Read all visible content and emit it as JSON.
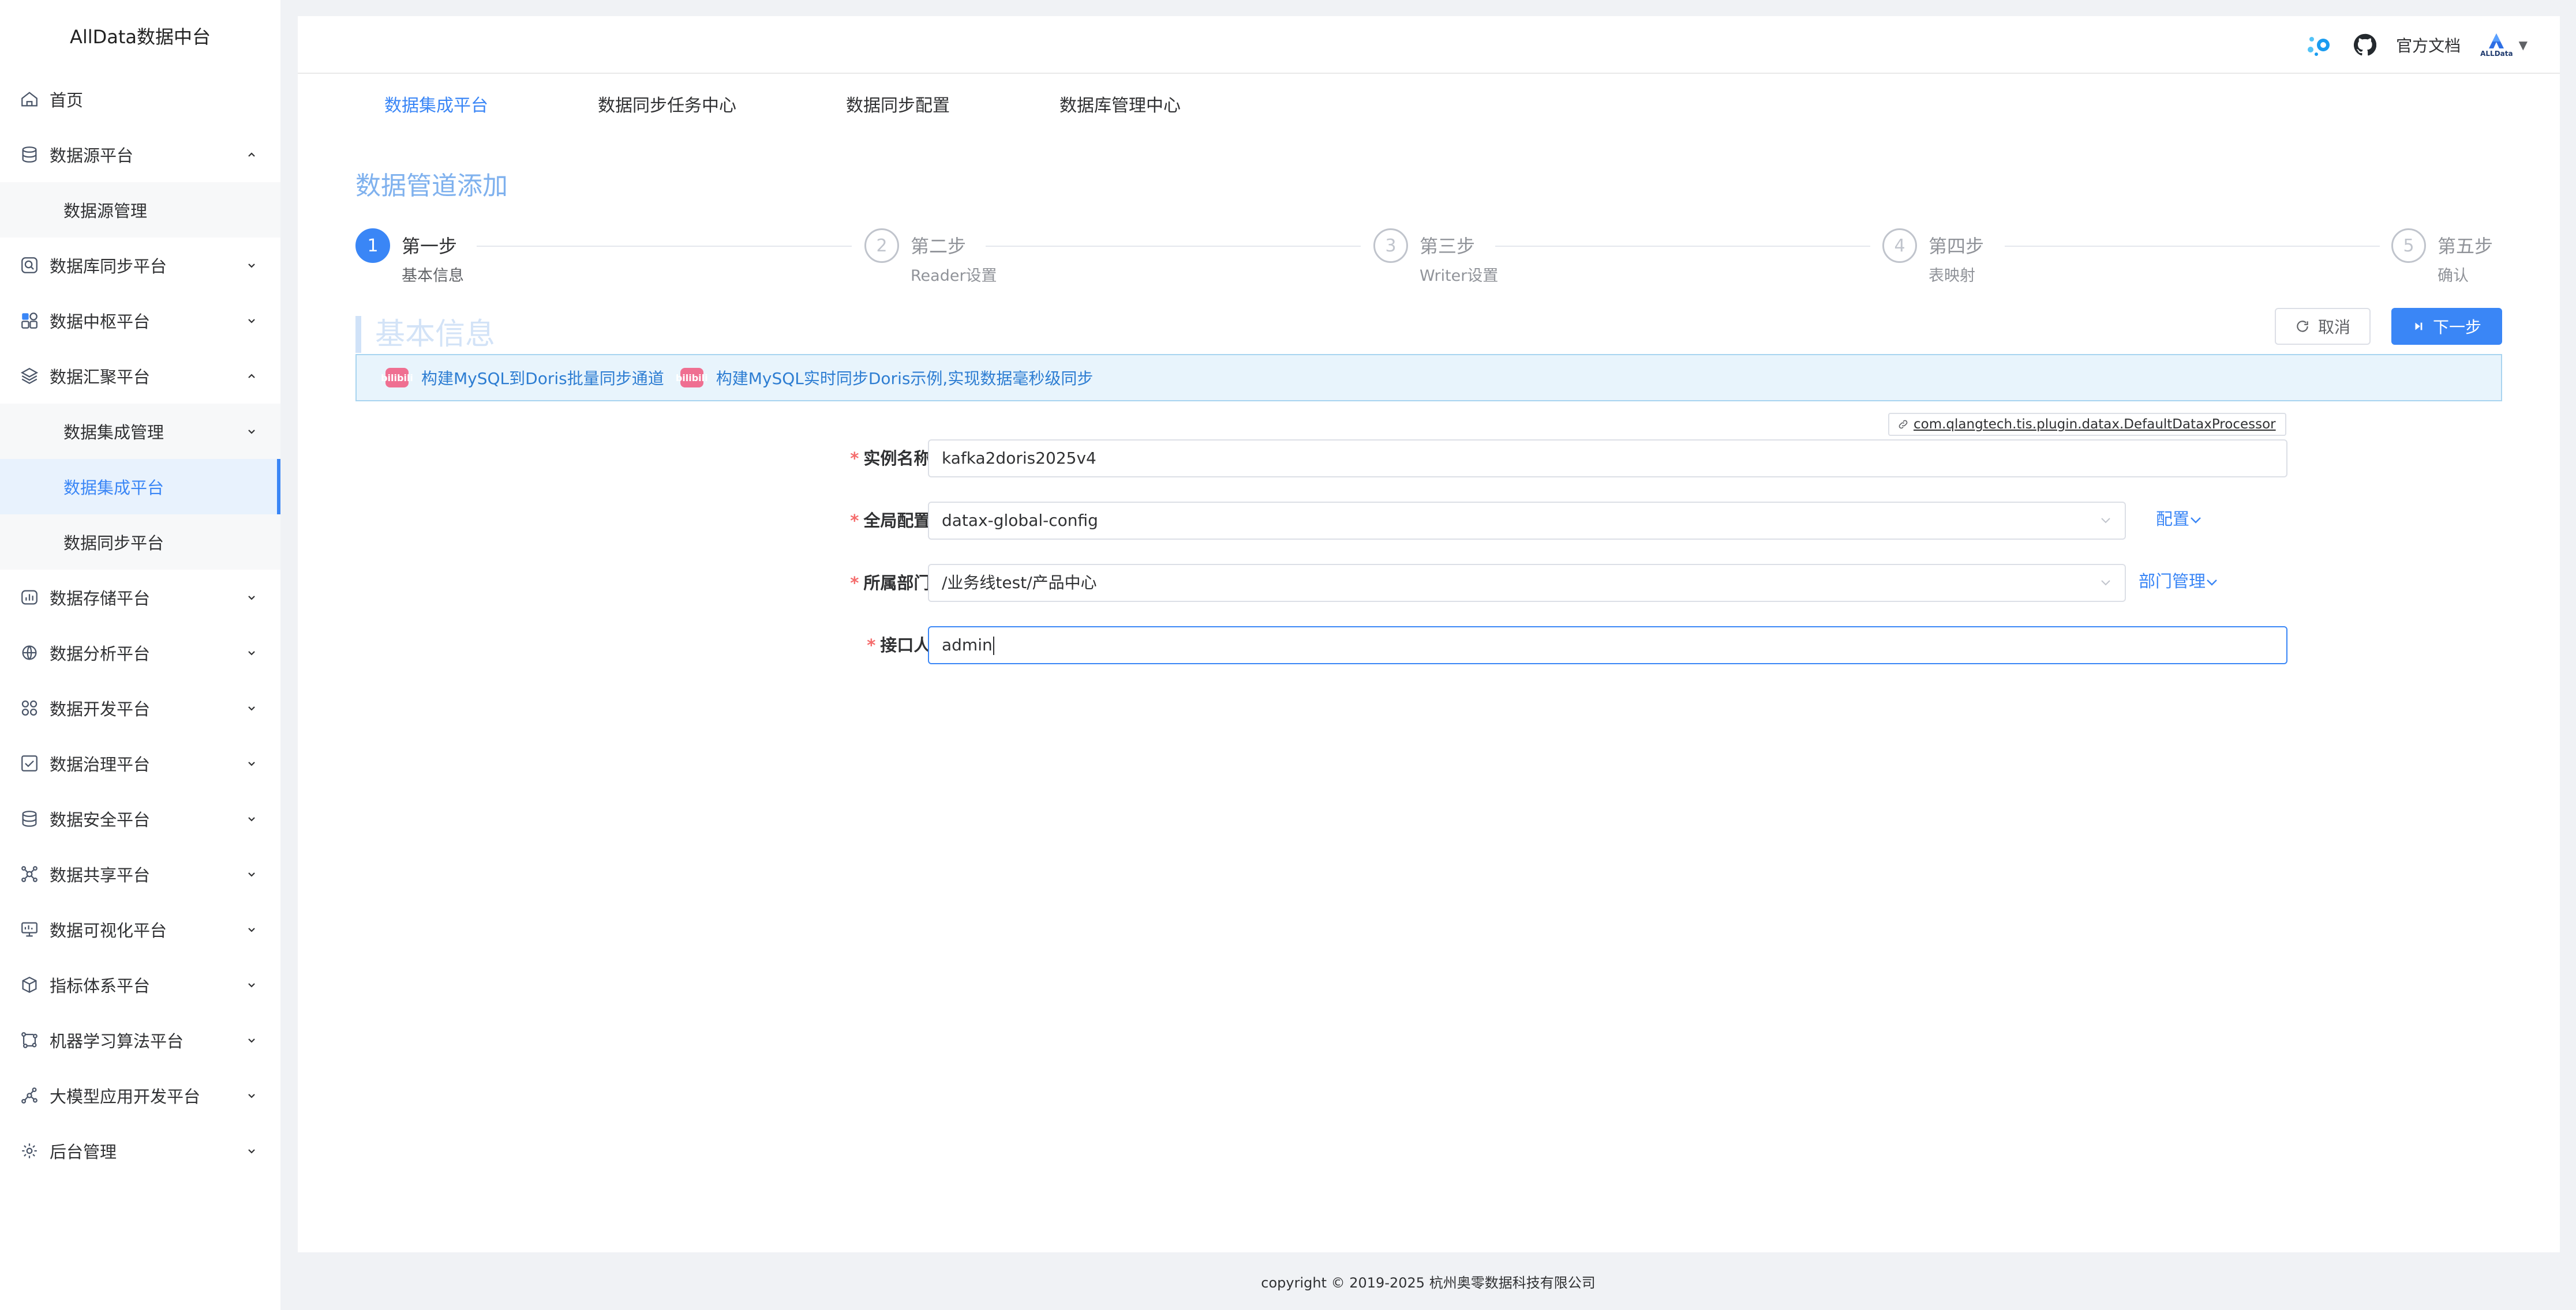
{
  "sidebar": {
    "logo": "AllData数据中台",
    "items": [
      {
        "label": "首页",
        "icon": "home-icon",
        "expanded": null
      },
      {
        "label": "数据源平台",
        "icon": "database-icon",
        "expanded": true
      },
      {
        "label": "数据源管理",
        "sub": true
      },
      {
        "label": "数据库同步平台",
        "icon": "sync-search-icon",
        "expanded": false
      },
      {
        "label": "数据中枢平台",
        "icon": "apps-icon",
        "expanded": false
      },
      {
        "label": "数据汇聚平台",
        "icon": "layers-icon",
        "expanded": true
      },
      {
        "label": "数据集成管理",
        "sub": true,
        "expanded": false
      },
      {
        "label": "数据集成平台",
        "sub": true,
        "active": true
      },
      {
        "label": "数据同步平台",
        "sub": true
      },
      {
        "label": "数据存储平台",
        "icon": "storage-chart-icon",
        "expanded": false
      },
      {
        "label": "数据分析平台",
        "icon": "analysis-icon",
        "expanded": false
      },
      {
        "label": "数据开发平台",
        "icon": "dev-grid-icon",
        "expanded": false
      },
      {
        "label": "数据治理平台",
        "icon": "checkbox-icon",
        "expanded": false
      },
      {
        "label": "数据安全平台",
        "icon": "security-db-icon",
        "expanded": false
      },
      {
        "label": "数据共享平台",
        "icon": "share-icon",
        "expanded": false
      },
      {
        "label": "数据可视化平台",
        "icon": "monitor-icon",
        "expanded": false
      },
      {
        "label": "指标体系平台",
        "icon": "cube-icon",
        "expanded": false
      },
      {
        "label": "机器学习算法平台",
        "icon": "ml-icon",
        "expanded": false
      },
      {
        "label": "大模型应用开发平台",
        "icon": "network-icon",
        "expanded": false
      },
      {
        "label": "后台管理",
        "icon": "settings-icon",
        "expanded": false
      }
    ]
  },
  "header": {
    "docs_label": "官方文档",
    "avatar_text": "ALLData",
    "avatar_caret": "▼"
  },
  "tabs": [
    {
      "label": "数据集成平台",
      "active": true
    },
    {
      "label": "数据同步任务中心",
      "active": false
    },
    {
      "label": "数据同步配置",
      "active": false
    },
    {
      "label": "数据库管理中心",
      "active": false
    }
  ],
  "page_title": "数据管道添加",
  "steps": [
    {
      "num": "1",
      "title": "第一步",
      "desc": "基本信息",
      "active": true
    },
    {
      "num": "2",
      "title": "第二步",
      "desc": "Reader设置",
      "active": false
    },
    {
      "num": "3",
      "title": "第三步",
      "desc": "Writer设置",
      "active": false
    },
    {
      "num": "4",
      "title": "第四步",
      "desc": "表映射",
      "active": false
    },
    {
      "num": "5",
      "title": "第五步",
      "desc": "确认",
      "active": false
    }
  ],
  "section_title": "基本信息",
  "buttons": {
    "cancel": "取消",
    "next": "下一步"
  },
  "banner": {
    "badge": "bilibili",
    "link1": "构建MySQL到Doris批量同步通道",
    "link2": "构建MySQL实时同步Doris示例,实现数据毫秒级同步"
  },
  "plugin_tag": "com.qlangtech.tis.plugin.datax.DefaultDataxProcessor",
  "form": {
    "instance_name": {
      "label": "实例名称:",
      "value": "kafka2doris2025v4"
    },
    "global_config": {
      "label": "全局配置:",
      "value": "datax-global-config",
      "link": "配置"
    },
    "department": {
      "label": "所属部门:",
      "value": "/业务线test/产品中心",
      "link": "部门管理"
    },
    "contact": {
      "label": "接口人:",
      "value": "admin"
    },
    "required_mark": "*"
  },
  "footer": "copyright © 2019-2025 杭州奥零数据科技有限公司",
  "colors": {
    "accent": "#3a86f6",
    "required": "#f56c6c",
    "banner_bg": "#e8f4fc"
  }
}
